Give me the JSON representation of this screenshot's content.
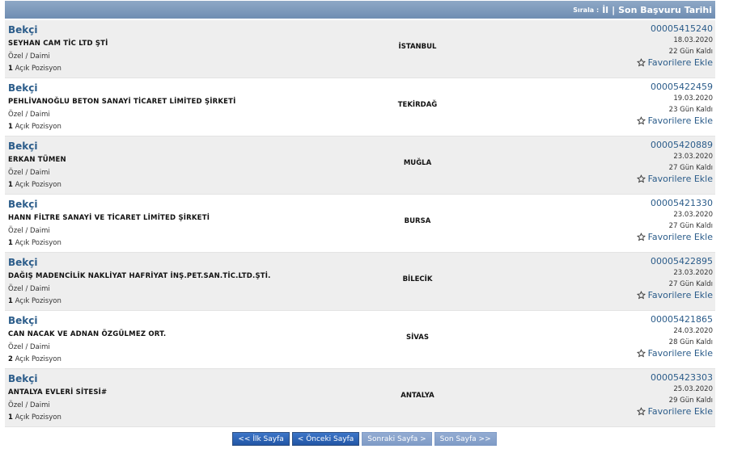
{
  "header": {
    "sort_label": "Sırala :",
    "sort_by_city": "İl",
    "separator": "|",
    "sort_by_deadline": "Son Başvuru Tarihi"
  },
  "jobs": [
    {
      "title": "Bekçi",
      "company": "SEYHAN CAM TİC LTD ŞTİ",
      "type": "Özel / Daimi",
      "positions_count": "1",
      "positions_label": "Açık Pozisyon",
      "city": "İSTANBUL",
      "id": "00005415240",
      "date": "18.03.2020",
      "days_left": "22 Gün Kaldı",
      "favorite": "Favorilere Ekle"
    },
    {
      "title": "Bekçi",
      "company": "PEHLİVANOĞLU BETON SANAYİ TİCARET LİMİTED ŞİRKETİ",
      "type": "Özel / Daimi",
      "positions_count": "1",
      "positions_label": "Açık Pozisyon",
      "city": "TEKİRDAĞ",
      "id": "00005422459",
      "date": "19.03.2020",
      "days_left": "23 Gün Kaldı",
      "favorite": "Favorilere Ekle"
    },
    {
      "title": "Bekçi",
      "company": "ERKAN TÜMEN",
      "type": "Özel / Daimi",
      "positions_count": "1",
      "positions_label": "Açık Pozisyon",
      "city": "MUĞLA",
      "id": "00005420889",
      "date": "23.03.2020",
      "days_left": "27 Gün Kaldı",
      "favorite": "Favorilere Ekle"
    },
    {
      "title": "Bekçi",
      "company": "HANN FİLTRE SANAYİ VE TİCARET LİMİTED ŞİRKETİ",
      "type": "Özel / Daimi",
      "positions_count": "1",
      "positions_label": "Açık Pozisyon",
      "city": "BURSA",
      "id": "00005421330",
      "date": "23.03.2020",
      "days_left": "27 Gün Kaldı",
      "favorite": "Favorilere Ekle"
    },
    {
      "title": "Bekçi",
      "company": "DAĞIŞ MADENCİLİK NAKLİYAT HAFRİYAT İNŞ.PET.SAN.TİC.LTD.ŞTİ.",
      "type": "Özel / Daimi",
      "positions_count": "1",
      "positions_label": "Açık Pozisyon",
      "city": "BİLECİK",
      "id": "00005422895",
      "date": "23.03.2020",
      "days_left": "27 Gün Kaldı",
      "favorite": "Favorilere Ekle"
    },
    {
      "title": "Bekçi",
      "company": "CAN NACAK VE ADNAN ÖZGÜLMEZ ORT.",
      "type": "Özel / Daimi",
      "positions_count": "2",
      "positions_label": "Açık Pozisyon",
      "city": "SİVAS",
      "id": "00005421865",
      "date": "24.03.2020",
      "days_left": "28 Gün Kaldı",
      "favorite": "Favorilere Ekle"
    },
    {
      "title": "Bekçi",
      "company": "ANTALYA EVLERİ SİTESİ#",
      "type": "Özel / Daimi",
      "positions_count": "1",
      "positions_label": "Açık Pozisyon",
      "city": "ANTALYA",
      "id": "00005423303",
      "date": "25.03.2020",
      "days_left": "29 Gün Kaldı",
      "favorite": "Favorilere Ekle"
    }
  ],
  "pager": {
    "first": "<< İlk Sayfa",
    "prev": "< Önceki Sayfa",
    "next": "Sonraki Sayfa >",
    "last": "Son Sayfa >>"
  },
  "colors": {
    "header_bar": "#7f9abb",
    "link": "#2b5c8a",
    "row_alt": "#eeeeee",
    "pager_active": "#2f64b5",
    "pager_inactive": "#8aa4cc"
  },
  "icons": {
    "favorite": "star-outline-icon"
  }
}
